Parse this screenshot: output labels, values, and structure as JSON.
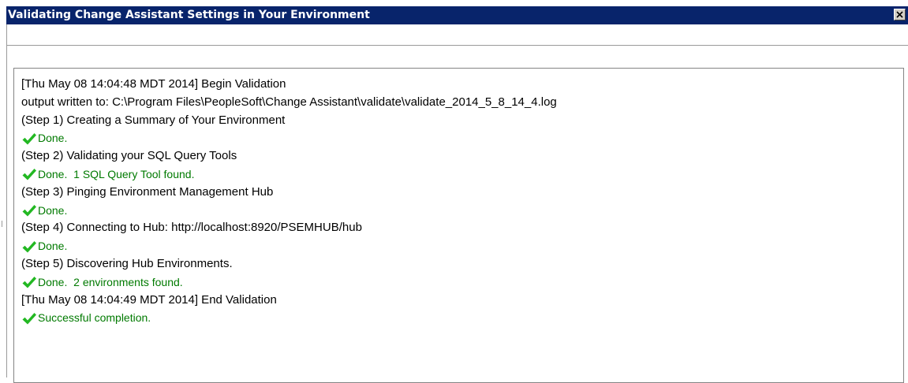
{
  "window": {
    "title": "Validating Change Assistant Settings in Your Environment",
    "close_icon": "close-icon"
  },
  "colors": {
    "titlebar": "#08246b",
    "success_text": "#007a00",
    "check_icon": "#22b822"
  },
  "log": {
    "lines": [
      {
        "kind": "text",
        "text": "[Thu May 08 14:04:48 MDT 2014] Begin Validation"
      },
      {
        "kind": "text",
        "text": "output written to: C:\\Program Files\\PeopleSoft\\Change Assistant\\validate\\validate_2014_5_8_14_4.log"
      },
      {
        "kind": "text",
        "text": "(Step 1) Creating a Summary of Your Environment"
      },
      {
        "kind": "ok",
        "icon": "check-icon",
        "text": "Done."
      },
      {
        "kind": "text",
        "text": "(Step 2) Validating your SQL Query Tools"
      },
      {
        "kind": "ok",
        "icon": "check-icon",
        "text": "Done.  1 SQL Query Tool found."
      },
      {
        "kind": "text",
        "text": "(Step 3) Pinging Environment Management Hub"
      },
      {
        "kind": "ok",
        "icon": "check-icon",
        "text": "Done."
      },
      {
        "kind": "text",
        "text": "(Step 4) Connecting to Hub: http://localhost:8920/PSEMHUB/hub"
      },
      {
        "kind": "ok",
        "icon": "check-icon",
        "text": "Done."
      },
      {
        "kind": "text",
        "text": "(Step 5) Discovering Hub Environments."
      },
      {
        "kind": "ok",
        "icon": "check-icon",
        "text": "Done.  2 environments found."
      },
      {
        "kind": "text",
        "text": "[Thu May 08 14:04:49 MDT 2014] End Validation"
      },
      {
        "kind": "ok",
        "icon": "check-icon",
        "text": "Successful completion."
      }
    ]
  }
}
